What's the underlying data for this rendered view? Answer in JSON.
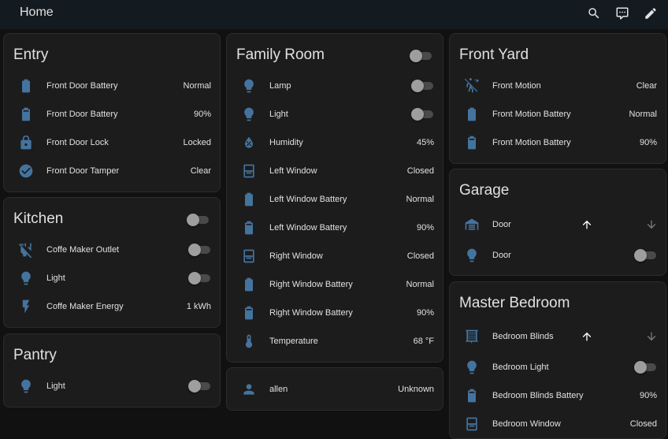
{
  "toolbar": {
    "title": "Home",
    "icons": [
      "search-icon",
      "assist-icon",
      "edit-icon"
    ]
  },
  "colors": {
    "icon_accent": "#44739e",
    "background": "#111111",
    "card": "#1c1c1c",
    "toolbar": "#141b20",
    "text": "#e1e1e1"
  },
  "cards": {
    "entry": {
      "title": "Entry",
      "rows": [
        {
          "name": "Front Door Battery",
          "state": "Normal",
          "icon": "battery-icon"
        },
        {
          "name": "Front Door Battery",
          "state": "90%",
          "icon": "battery-90-icon"
        },
        {
          "name": "Front Door Lock",
          "state": "Locked",
          "icon": "lock-icon"
        },
        {
          "name": "Front Door Tamper",
          "state": "Clear",
          "icon": "check-circle-icon"
        }
      ]
    },
    "kitchen": {
      "title": "Kitchen",
      "header_toggle": false,
      "rows": [
        {
          "name": "Coffe Maker Outlet",
          "toggle": false,
          "icon": "power-plug-off-icon"
        },
        {
          "name": "Light",
          "toggle": false,
          "icon": "lightbulb-icon"
        },
        {
          "name": "Coffe Maker Energy",
          "state": "1 kWh",
          "icon": "flash-icon"
        }
      ]
    },
    "pantry": {
      "title": "Pantry",
      "rows": [
        {
          "name": "Light",
          "toggle": false,
          "icon": "lightbulb-icon"
        }
      ]
    },
    "family_room": {
      "title": "Family Room",
      "header_toggle": false,
      "rows": [
        {
          "name": "Lamp",
          "toggle": false,
          "icon": "lightbulb-icon"
        },
        {
          "name": "Light",
          "toggle": false,
          "icon": "lightbulb-icon"
        },
        {
          "name": "Humidity",
          "state": "45%",
          "icon": "water-percent-icon"
        },
        {
          "name": "Left Window",
          "state": "Closed",
          "icon": "window-closed-icon"
        },
        {
          "name": "Left Window Battery",
          "state": "Normal",
          "icon": "battery-icon"
        },
        {
          "name": "Left Window Battery",
          "state": "90%",
          "icon": "battery-90-icon"
        },
        {
          "name": "Right Window",
          "state": "Closed",
          "icon": "window-closed-icon"
        },
        {
          "name": "Right Window Battery",
          "state": "Normal",
          "icon": "battery-icon"
        },
        {
          "name": "Right Window Battery",
          "state": "90%",
          "icon": "battery-90-icon"
        },
        {
          "name": "Temperature",
          "state": "68 °F",
          "icon": "thermometer-icon"
        }
      ]
    },
    "person": {
      "rows": [
        {
          "name": "allen",
          "state": "Unknown",
          "icon": "account-icon"
        }
      ]
    },
    "front_yard": {
      "title": "Front Yard",
      "rows": [
        {
          "name": "Front Motion",
          "state": "Clear",
          "icon": "motion-sensor-off-icon"
        },
        {
          "name": "Front Motion Battery",
          "state": "Normal",
          "icon": "battery-icon"
        },
        {
          "name": "Front Motion Battery",
          "state": "90%",
          "icon": "battery-90-icon"
        }
      ]
    },
    "garage": {
      "title": "Garage",
      "rows": [
        {
          "name": "Door",
          "icon": "garage-icon",
          "cover": true
        },
        {
          "name": "Door",
          "toggle": false,
          "icon": "lightbulb-icon"
        }
      ]
    },
    "master_bedroom": {
      "title": "Master Bedroom",
      "rows": [
        {
          "name": "Bedroom Blinds",
          "icon": "blinds-icon",
          "cover": true
        },
        {
          "name": "Bedroom Light",
          "toggle": false,
          "icon": "lightbulb-icon"
        },
        {
          "name": "Bedroom Blinds Battery",
          "state": "90%",
          "icon": "battery-90-icon"
        },
        {
          "name": "Bedroom Window",
          "state": "Closed",
          "icon": "window-closed-icon"
        }
      ]
    }
  }
}
